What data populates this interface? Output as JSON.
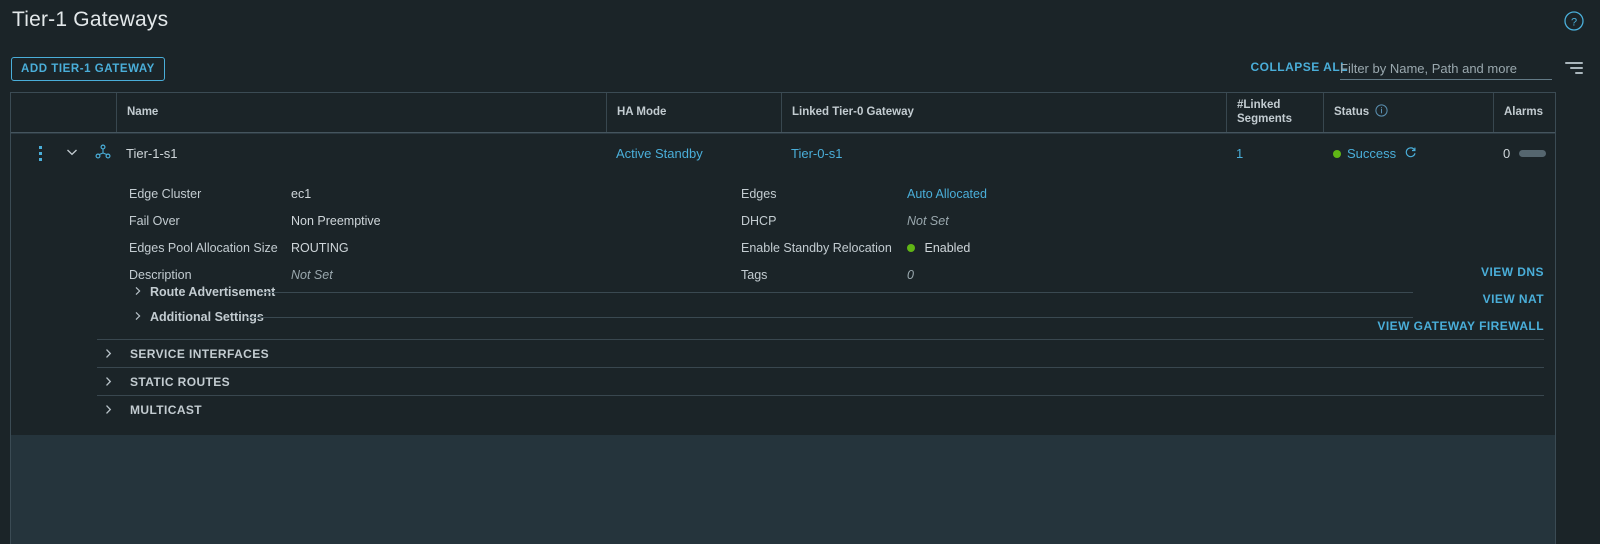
{
  "page": {
    "title": "Tier-1 Gateways",
    "help_icon": "help-circle-icon"
  },
  "toolbar": {
    "add_button": "ADD TIER-1 GATEWAY",
    "collapse_all": "COLLAPSE ALL",
    "filter_placeholder": "Filter by Name, Path and more",
    "filter_value": "",
    "filter_icon": "filter-icon"
  },
  "table": {
    "columns": [
      {
        "label": ""
      },
      {
        "label": "Name"
      },
      {
        "label": "HA Mode"
      },
      {
        "label": "Linked Tier-0 Gateway"
      },
      {
        "label": "#Linked\nSegments"
      },
      {
        "label": "Status"
      },
      {
        "label": "Alarms"
      }
    ],
    "column_labels": {
      "blank": "",
      "name": "Name",
      "ha_mode": "HA Mode",
      "linked_t0": "Linked Tier-0 Gateway",
      "linked_segments_line1": "#Linked",
      "linked_segments_line2": "Segments",
      "status": "Status",
      "alarms": "Alarms"
    },
    "row": {
      "name": "Tier-1-s1",
      "ha_mode": "Active Standby",
      "linked_tier0_gateway": "Tier-0-s1",
      "linked_segments": "1",
      "status": "Success",
      "alarms": "0"
    }
  },
  "detail": {
    "left": [
      {
        "label": "Edge Cluster",
        "value": "ec1",
        "style": "plain"
      },
      {
        "label": "Fail Over",
        "value": "Non Preemptive",
        "style": "plain"
      },
      {
        "label": "Edges Pool Allocation Size",
        "value": "ROUTING",
        "style": "plain"
      },
      {
        "label": "Description",
        "value": "Not Set",
        "style": "muted"
      }
    ],
    "right": [
      {
        "label": "Edges",
        "value": "Auto Allocated",
        "style": "link"
      },
      {
        "label": "DHCP",
        "value": "Not Set",
        "style": "muted"
      },
      {
        "label": "Enable Standby Relocation",
        "value": "Enabled",
        "style": "dot"
      },
      {
        "label": "Tags",
        "value": "0",
        "style": "muted"
      }
    ],
    "sub_sections": [
      {
        "label": "Route Advertisement"
      },
      {
        "label": "Additional Settings"
      }
    ],
    "view_links": [
      {
        "label": "VIEW DNS"
      },
      {
        "label": "VIEW NAT"
      },
      {
        "label": "VIEW GATEWAY FIREWALL"
      }
    ],
    "sections": [
      {
        "label": "SERVICE INTERFACES"
      },
      {
        "label": "STATIC ROUTES"
      },
      {
        "label": "MULTICAST"
      }
    ]
  },
  "colors": {
    "background": "#1b2428",
    "accent_link": "#4aaed9",
    "status_green": "#60b515",
    "panel": "#25343c",
    "border": "#3b4b54",
    "text": "#cfd6da"
  }
}
